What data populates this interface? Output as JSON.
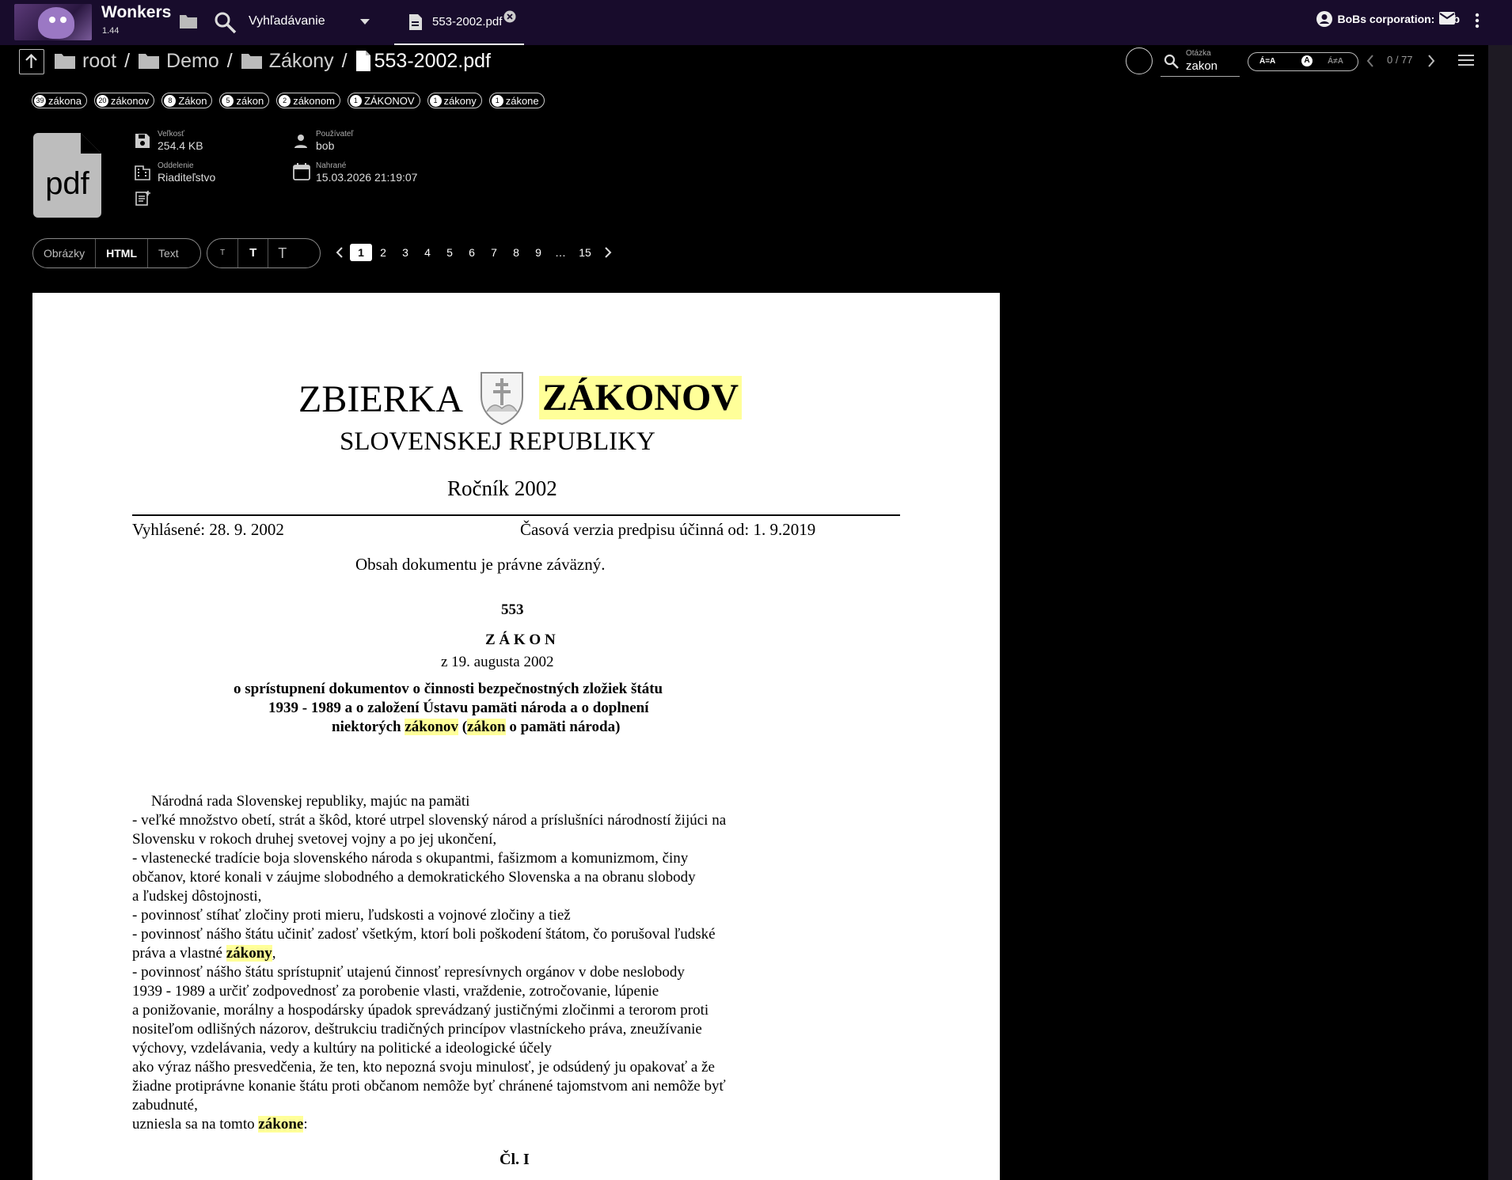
{
  "app": {
    "name": "Wonkers",
    "version": "1.44"
  },
  "topbar": {
    "search_label": "Vyhľadávanie",
    "tab_label": "553-2002.pdf",
    "user_label": "BoBs corporation:",
    "user_name": "bob"
  },
  "breadcrumb": {
    "items": [
      "root",
      "Demo",
      "Zákony"
    ],
    "current": "553-2002.pdf"
  },
  "search": {
    "caption": "Otázka",
    "value": "zakon",
    "case_options": [
      "Á=A",
      "A",
      "Á≠A"
    ],
    "count": "0 / 77"
  },
  "chips": [
    {
      "count": "39",
      "label": "zákona"
    },
    {
      "count": "20",
      "label": "zákonov"
    },
    {
      "count": "8",
      "label": "Zákon"
    },
    {
      "count": "5",
      "label": "zákon"
    },
    {
      "count": "2",
      "label": "zákonom"
    },
    {
      "count": "1",
      "label": "ZÁKONOV"
    },
    {
      "count": "1",
      "label": "zákony"
    },
    {
      "count": "1",
      "label": "zákone"
    }
  ],
  "file": {
    "icon_text": "pdf",
    "size_caption": "Veľkosť",
    "size": "254.4 KB",
    "dept_caption": "Oddelenie",
    "dept": "Riaditeľstvo",
    "user_caption": "Používateľ",
    "user": "bob",
    "uploaded_caption": "Nahrané",
    "uploaded": "15.03.2026 21:19:07"
  },
  "view_modes": [
    "Obrázky",
    "HTML",
    "Text"
  ],
  "font_sizes": [
    "T",
    "T",
    "T"
  ],
  "pager": {
    "pages": [
      "1",
      "2",
      "3",
      "4",
      "5",
      "6",
      "7",
      "8",
      "9",
      "…",
      "15"
    ],
    "current": "1"
  },
  "document": {
    "title_left": "ZBIERKA",
    "title_right": "ZÁKONOV",
    "subtitle": "SLOVENSKEJ REPUBLIKY",
    "year": "Ročník 2002",
    "announced": "Vyhlásené: 28. 9. 2002",
    "version": "Časová verzia predpisu účinná od: 1. 9.2019",
    "binding": "Obsah dokumentu je právne záväzný.",
    "number": "553",
    "kind": "Z Á K O N",
    "date": "z 19. augusta 2002",
    "heading1": "o sprístupnení dokumentov o činnosti bezpečnostných zložiek štátu",
    "heading2": "1939 - 1989 a o založení Ústavu pamäti národa a o doplnení",
    "heading3a": "niektorých ",
    "heading3b": "zákonov",
    "heading3c": " (",
    "heading3d": "zákon",
    "heading3e": " o pamäti národa)",
    "lines": [
      "Národná rada Slovenskej republiky, majúc na pamäti",
      "- veľké množstvo obetí, strát a škôd, ktoré utrpel slovenský národ a príslušníci národností žijúci na",
      "Slovensku v rokoch druhej svetovej vojny a po jej ukončení,",
      "- vlastenecké tradície boja slovenského národa s okupantmi, fašizmom a komunizmom, činy",
      "občanov, ktoré konali v záujme slobodného a demokratického Slovenska a na obranu slobody",
      "a ľudskej dôstojnosti,",
      "- povinnosť stíhať zločiny proti mieru, ľudskosti a vojnové zločiny a tiež",
      "- povinnosť nášho štátu učiniť zadosť všetkým, ktorí boli poškodení štátom, čo porušoval ľudské"
    ],
    "line9a": "práva a vlastné ",
    "line9b": "zákony",
    "line9c": ",",
    "lines2": [
      "- povinnosť nášho štátu sprístupniť utajenú činnosť represívnych orgánov v dobe neslobody",
      "1939 - 1989 a určiť zodpovednosť za porobenie vlasti, vraždenie, zotročovanie, lúpenie",
      "a ponižovanie, morálny a hospodársky úpadok sprevádzaný justičnými zločinmi a terorom proti",
      "nositeľom odlišných názorov, deštrukciu tradičných princípov vlastníckeho práva, zneužívanie",
      "výchovy, vzdelávania, vedy a kultúry na politické a ideologické účely",
      "ako výraz nášho presvedčenia, že ten, kto nepozná svoju minulosť, je odsúdený ju opakovať a že",
      "žiadne protiprávne konanie štátu proti občanom nemôže byť chránené tajomstvom ani nemôže byť",
      "zabudnuté,"
    ],
    "last_a": "uzniesla sa na tomto ",
    "last_b": "zákone",
    "last_c": ":",
    "article": "Čl. I"
  }
}
